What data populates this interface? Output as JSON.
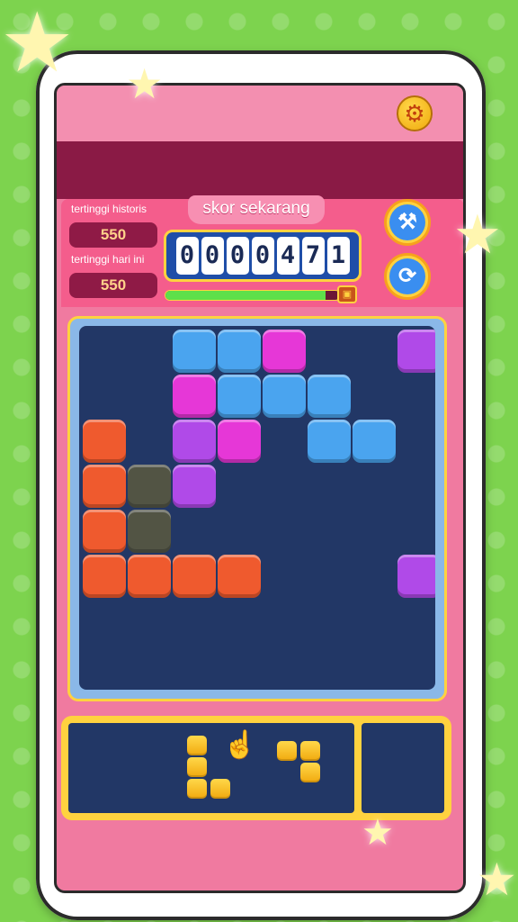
{
  "header": {
    "settings_icon": "gear-icon"
  },
  "score": {
    "title": "skor sekarang",
    "historical_high_label": "tertinggi historis",
    "historical_high_value": "550",
    "today_high_label": "tertinggi hari ini",
    "today_high_value": "550",
    "digits": [
      "0",
      "0",
      "0",
      "0",
      "4",
      "7",
      "1"
    ],
    "progress_fraction": 0.92,
    "chest_icon": "treasure-chest-icon"
  },
  "buttons": {
    "hammer_icon": "hammer-icon",
    "refresh_icon": "refresh-icon"
  },
  "colors": {
    "blue": "#4aa4ef",
    "magenta": "#e637d7",
    "purple": "#b04ae8",
    "orange": "#ef5a2e",
    "ghost": "#5b5a3f",
    "yellow": "#f4bd1c"
  },
  "board": {
    "rows": 8,
    "cols": 8,
    "cells": [
      {
        "r": 0,
        "c": 2,
        "color": "blue"
      },
      {
        "r": 0,
        "c": 3,
        "color": "blue"
      },
      {
        "r": 0,
        "c": 4,
        "color": "magenta"
      },
      {
        "r": 0,
        "c": 7,
        "color": "purple"
      },
      {
        "r": 1,
        "c": 2,
        "color": "magenta"
      },
      {
        "r": 1,
        "c": 3,
        "color": "blue"
      },
      {
        "r": 1,
        "c": 4,
        "color": "blue"
      },
      {
        "r": 1,
        "c": 5,
        "color": "blue"
      },
      {
        "r": 2,
        "c": 0,
        "color": "orange"
      },
      {
        "r": 2,
        "c": 2,
        "color": "purple"
      },
      {
        "r": 2,
        "c": 3,
        "color": "magenta"
      },
      {
        "r": 2,
        "c": 5,
        "color": "blue"
      },
      {
        "r": 2,
        "c": 6,
        "color": "blue"
      },
      {
        "r": 3,
        "c": 0,
        "color": "orange"
      },
      {
        "r": 3,
        "c": 1,
        "color": "ghost"
      },
      {
        "r": 3,
        "c": 2,
        "color": "purple"
      },
      {
        "r": 4,
        "c": 0,
        "color": "orange"
      },
      {
        "r": 4,
        "c": 1,
        "color": "ghost"
      },
      {
        "r": 5,
        "c": 0,
        "color": "orange"
      },
      {
        "r": 5,
        "c": 1,
        "color": "orange"
      },
      {
        "r": 5,
        "c": 2,
        "color": "orange"
      },
      {
        "r": 5,
        "c": 3,
        "color": "orange"
      },
      {
        "r": 5,
        "c": 7,
        "color": "purple"
      }
    ]
  },
  "tray": {
    "pieces": [
      {
        "name": "l-piece",
        "blocks": [
          [
            0,
            0
          ],
          [
            1,
            0
          ],
          [
            2,
            0
          ],
          [
            2,
            1
          ]
        ]
      },
      {
        "name": "z-piece",
        "blocks": [
          [
            0,
            0
          ],
          [
            0,
            1
          ],
          [
            1,
            1
          ]
        ]
      }
    ]
  },
  "hint": {
    "hand_icon": "pointing-hand-icon"
  }
}
